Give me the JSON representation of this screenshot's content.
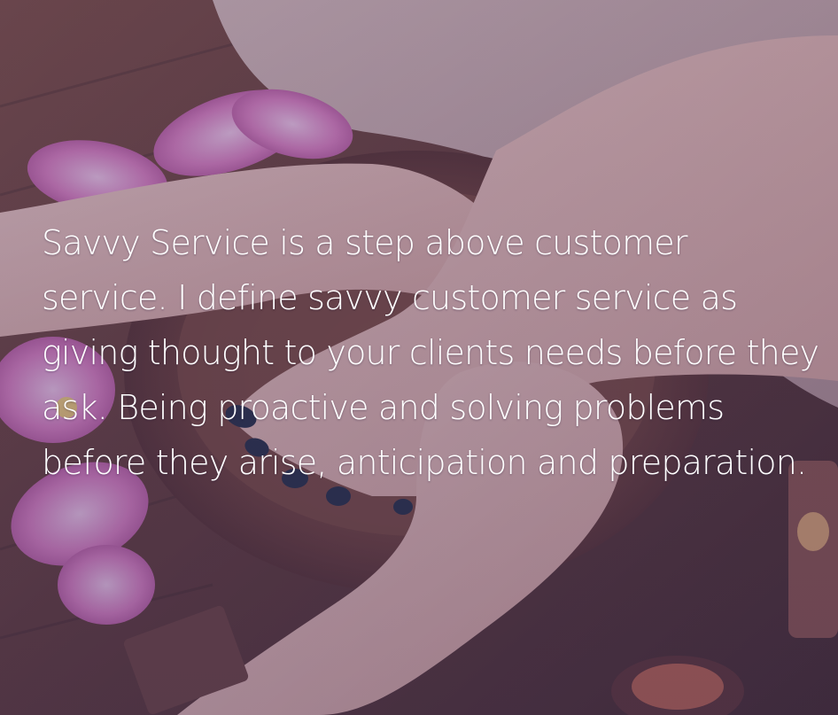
{
  "colors": {
    "overlay": "#4b4f8c",
    "text": "#ffffff",
    "wood": "#6b3b2a",
    "orchid": "#d36aa7",
    "towel": "#c9a8a0",
    "skin": "#e8b8a8",
    "nail_polish": "#1f2433"
  },
  "image": {
    "subject_icon": "foot-massage-photo",
    "elements": [
      "wooden-bowl",
      "orchid-flowers",
      "towel",
      "candle",
      "hands",
      "foot"
    ]
  },
  "quote": {
    "text": " Savvy Service is a step above customer service. I define savvy customer service as giving thought to your clients needs before they ask. Being proactive and solving problems before they arise, anticipation and preparation."
  }
}
